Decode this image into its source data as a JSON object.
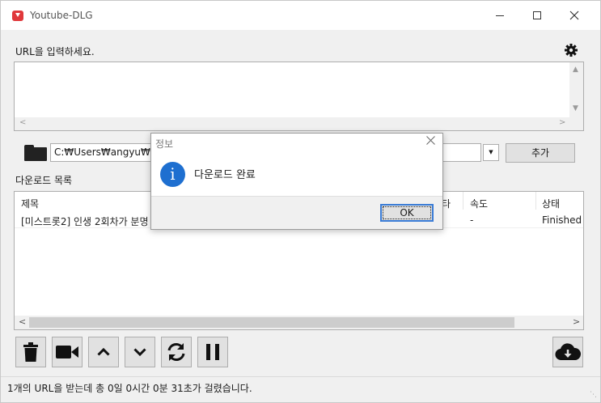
{
  "window": {
    "title": "Youtube-DLG",
    "minimize_icon": "minimize-icon",
    "maximize_icon": "maximize-icon",
    "close_icon": "close-icon"
  },
  "url_section": {
    "label": "URL을 입력하세요.",
    "settings_icon": "gear-icon",
    "value": ""
  },
  "save_path": {
    "folder_icon": "folder-icon",
    "value": "C:₩Users₩angyu₩Dov",
    "add_button": "추가"
  },
  "download_list": {
    "label": "다운로드 목록",
    "columns": [
      "제목",
      "타",
      "속도",
      "상태"
    ],
    "rows": [
      {
        "title": "[미스트롯2] 인생 2회차가 분명",
        "speed": "-",
        "status": "Finished"
      }
    ]
  },
  "toolbar": {
    "buttons": [
      "trash-icon",
      "video-camera-icon",
      "chevron-up-icon",
      "chevron-down-icon",
      "refresh-icon",
      "pause-icon",
      "cloud-download-icon"
    ]
  },
  "status_bar": {
    "text": "1개의 URL을 받는데 총 0일 0시간 0분 31초가 걸렸습니다."
  },
  "dialog": {
    "title": "정보",
    "message": "다운로드 완료",
    "ok_label": "OK",
    "icon": "info-icon"
  },
  "colors": {
    "accent": "#3a7cd6",
    "info_icon": "#1e6fd0",
    "app_icon": "#e0383b"
  }
}
